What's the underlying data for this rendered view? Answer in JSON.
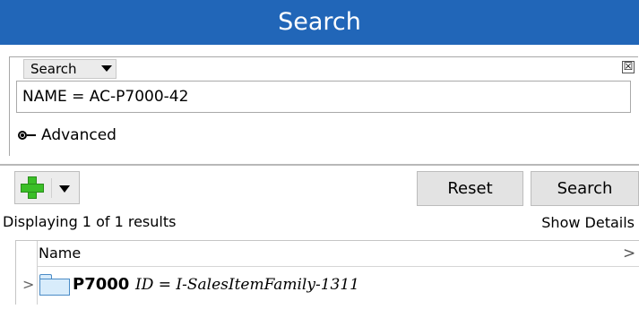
{
  "header": {
    "title": "Search"
  },
  "search_group": {
    "combo_label": "Search",
    "close_label": "☒",
    "query_value": "NAME = AC-P7000-42",
    "advanced_label": "Advanced"
  },
  "toolbar": {
    "reset_label": "Reset",
    "search_label": "Search"
  },
  "results": {
    "count_text": "Displaying 1 of 1 results",
    "show_details_label": "Show Details",
    "columns": [
      "Name"
    ],
    "header_chevron": ">",
    "rows": [
      {
        "expander": ">",
        "name": "P7000",
        "id_text": "ID = I-SalesItemFamily-1311"
      }
    ]
  }
}
